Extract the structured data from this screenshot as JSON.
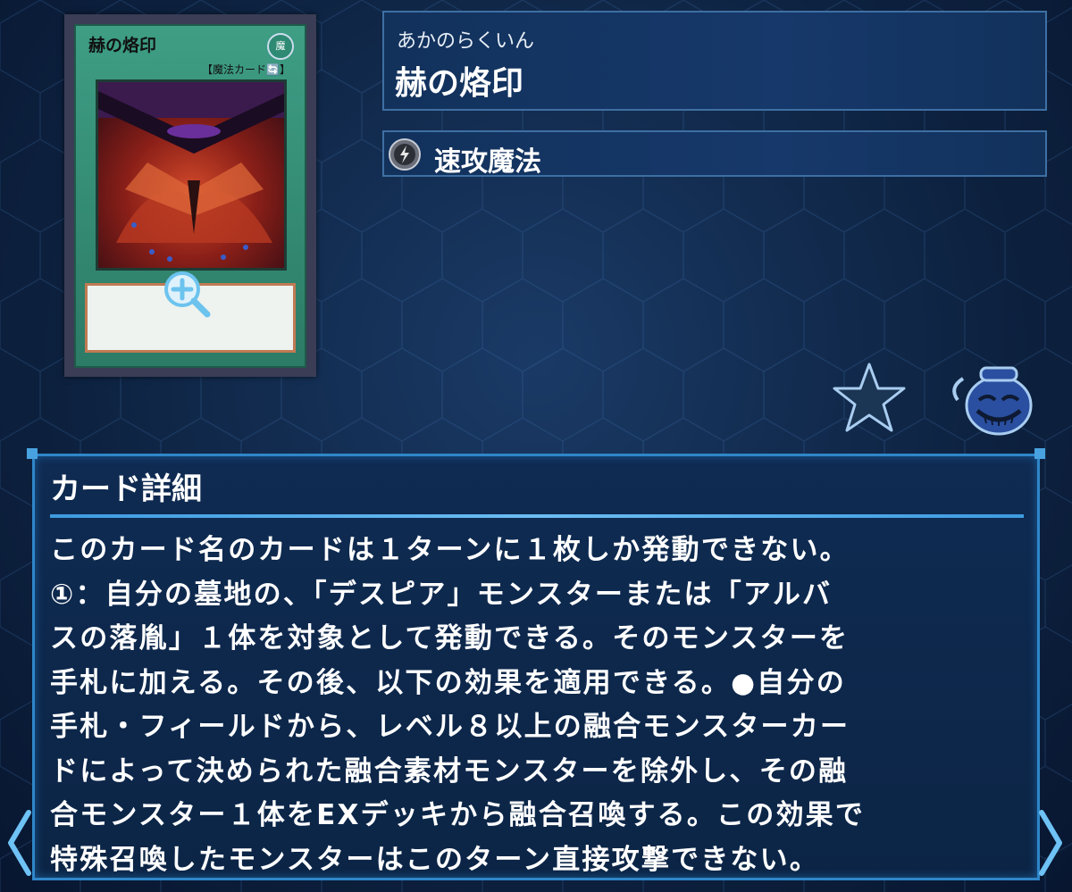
{
  "card": {
    "image_name": "赫の烙印",
    "image_attribute": "魔",
    "image_type": "【魔法カード🔄】"
  },
  "header": {
    "ruby": "あかのらくいん",
    "title": "赫の烙印"
  },
  "type": {
    "icon": "quick-play-spell-icon",
    "label": "速攻魔法"
  },
  "actions": {
    "favorite_icon": "star-icon",
    "pot_icon": "pot-of-greed-icon"
  },
  "detail": {
    "heading": "カード詳細",
    "text": "このカード名のカードは１ターンに１枚しか発動できない。\n①：自分の墓地の、「デスピア」モンスターまたは「アルバ\nスの落胤」１体を対象として発動できる。そのモンスターを\n手札に加える。その後、以下の効果を適用できる。●自分の\n手札・フィールドから、レベル８以上の融合モンスターカー\nドによって決められた融合素材モンスターを除外し、その融\n合モンスター１体をEXデッキから融合召喚する。この効果で\n特殊召喚したモンスターはこのターン直接攻撃できない。"
  },
  "nav": {
    "prev_icon": "chevron-left-icon",
    "next_icon": "chevron-right-icon"
  },
  "colors": {
    "background": "#0d2240",
    "panel_border": "#2f86c8",
    "spell_card": "#3e9e84"
  }
}
